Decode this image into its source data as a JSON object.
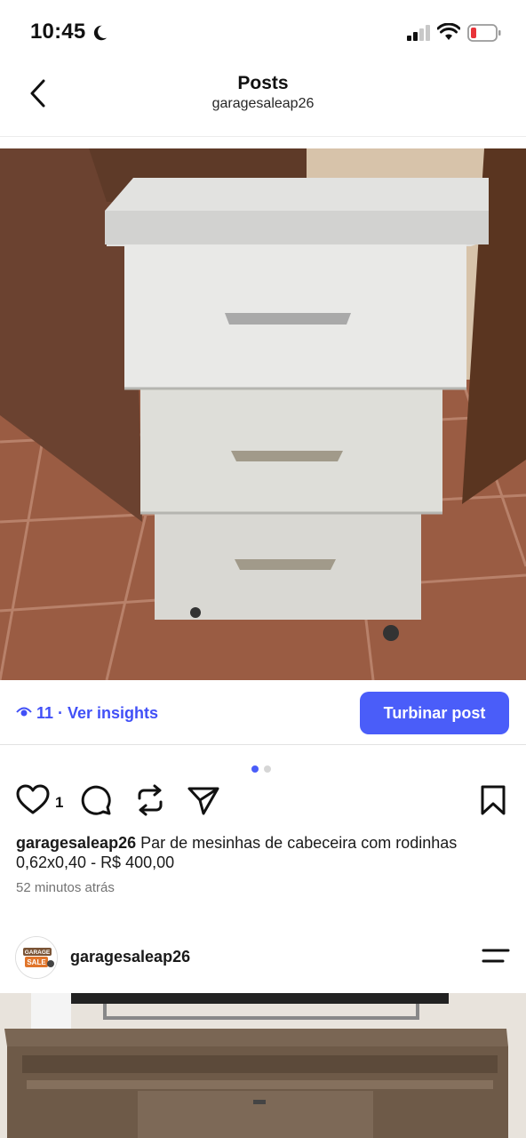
{
  "status_bar": {
    "time": "10:45"
  },
  "header": {
    "title": "Posts",
    "subtitle": "garagesaleap26"
  },
  "insights": {
    "text": "11 · Ver insights",
    "boost_label": "Turbinar post"
  },
  "post": {
    "likes": "1",
    "username": "garagesaleap26",
    "caption": " Par de mesinhas de cabeceira com rodinhas 0,62x0,40 - R$ 400,00",
    "time_ago": "52 minutos atrás",
    "carousel": {
      "current": 1,
      "total": 2
    }
  },
  "next_post": {
    "username": "garagesaleap26",
    "avatar_text_1": "GARAGE",
    "avatar_text_2": "SALE"
  },
  "colors": {
    "accent": "#4a5df9",
    "insights_text": "#4150f7"
  },
  "icons": [
    "moon-icon",
    "signal-icon",
    "wifi-icon",
    "battery-icon",
    "back-icon",
    "eye-icon",
    "heart-icon",
    "comment-icon",
    "repost-icon",
    "share-icon",
    "bookmark-icon",
    "menu-icon"
  ]
}
